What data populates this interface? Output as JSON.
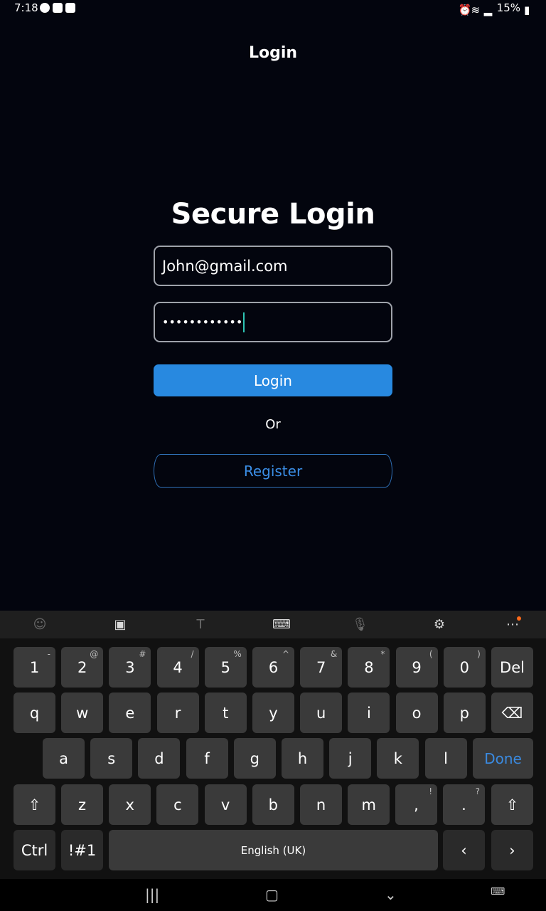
{
  "status_bar": {
    "time": "7:18",
    "battery": "15%"
  },
  "app_bar": {
    "title": "Login"
  },
  "form": {
    "headline": "Secure Login",
    "email_value": "John@gmail.com",
    "password_value": "••••••••••••",
    "login_label": "Login",
    "or_label": "Or",
    "register_label": "Register"
  },
  "keyboard": {
    "number_row": [
      {
        "k": "1",
        "s": "-"
      },
      {
        "k": "2",
        "s": "@"
      },
      {
        "k": "3",
        "s": "#"
      },
      {
        "k": "4",
        "s": "/"
      },
      {
        "k": "5",
        "s": "%"
      },
      {
        "k": "6",
        "s": "^"
      },
      {
        "k": "7",
        "s": "&"
      },
      {
        "k": "8",
        "s": "*"
      },
      {
        "k": "9",
        "s": "("
      },
      {
        "k": "0",
        "s": ")"
      }
    ],
    "del_label": "Del",
    "row_q": [
      "q",
      "w",
      "e",
      "r",
      "t",
      "y",
      "u",
      "i",
      "o",
      "p"
    ],
    "row_a": [
      "a",
      "s",
      "d",
      "f",
      "g",
      "h",
      "j",
      "k",
      "l"
    ],
    "done_label": "Done",
    "row_z": [
      "z",
      "x",
      "c",
      "v",
      "b",
      "n",
      "m"
    ],
    "comma_key": {
      "k": ",",
      "s": "!"
    },
    "period_key": {
      "k": ".",
      "s": "?"
    },
    "ctrl_label": "Ctrl",
    "symbols_label": "!#1",
    "space_label": "English (UK)"
  },
  "colors": {
    "accent": "#2889e0",
    "background": "#03050e",
    "register_text": "#3b8ee6"
  }
}
